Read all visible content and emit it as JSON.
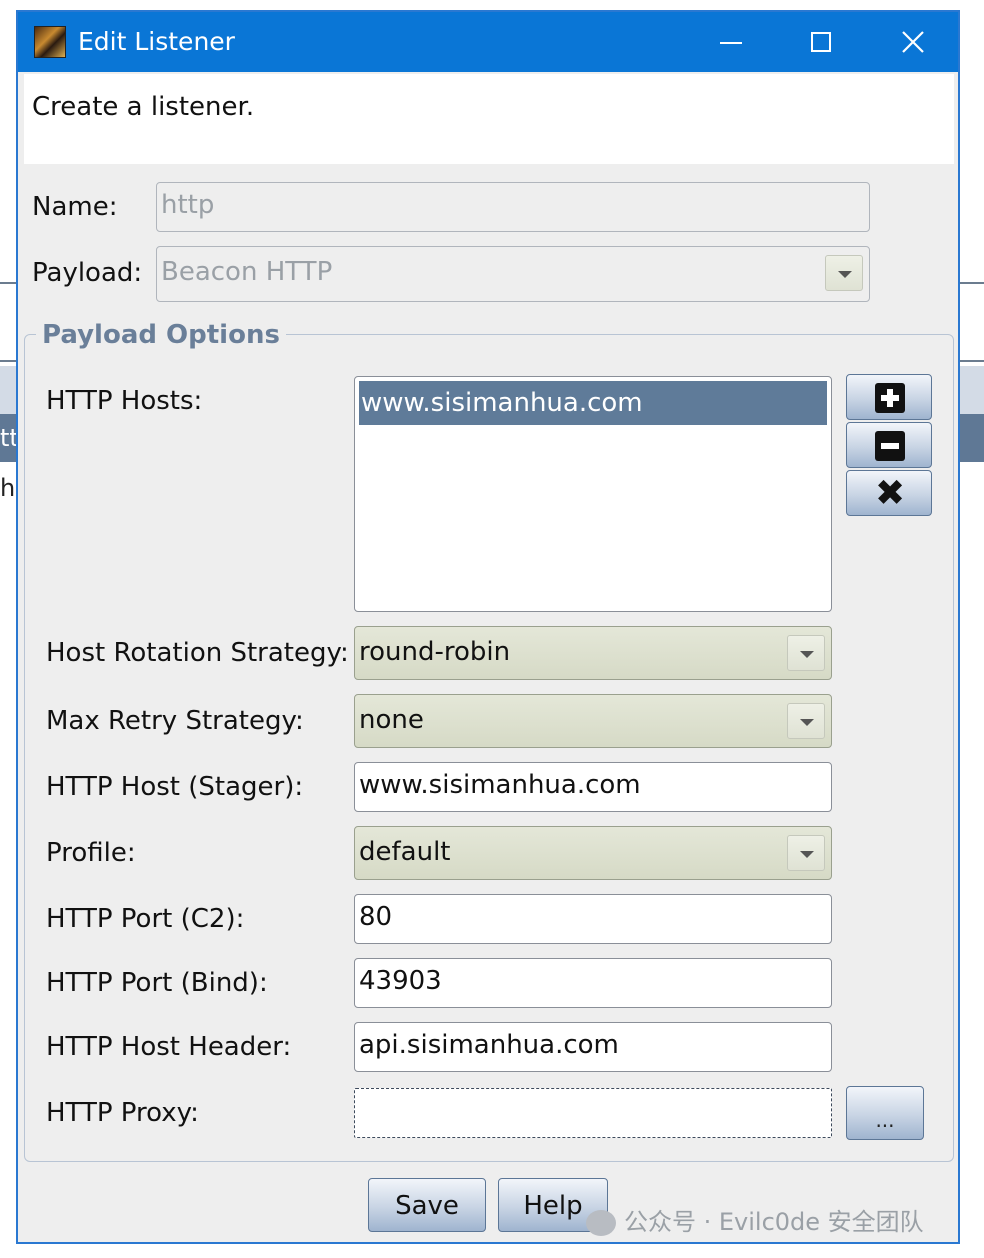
{
  "window": {
    "title": "Edit Listener"
  },
  "header": {
    "text": "Create a listener."
  },
  "form": {
    "name_label": "Name:",
    "name_value": "http",
    "payload_label": "Payload:",
    "payload_value": "Beacon HTTP"
  },
  "payload_options": {
    "title": "Payload Options",
    "http_hosts_label": "HTTP Hosts:",
    "http_hosts": [
      "www.sisimanhua.com"
    ],
    "rotation_label": "Host Rotation Strategy:",
    "rotation_value": "round-robin",
    "retry_label": "Max Retry Strategy:",
    "retry_value": "none",
    "stager_label": "HTTP Host (Stager):",
    "stager_value": "www.sisimanhua.com",
    "profile_label": "Profile:",
    "profile_value": "default",
    "port_c2_label": "HTTP Port (C2):",
    "port_c2_value": "80",
    "port_bind_label": "HTTP Port (Bind):",
    "port_bind_value": "43903",
    "host_header_label": "HTTP Host Header:",
    "host_header_value": "api.sisimanhua.com",
    "proxy_label": "HTTP Proxy:",
    "proxy_value": "",
    "proxy_button": "..."
  },
  "buttons": {
    "save": "Save",
    "help": "Help"
  },
  "background": {
    "fragment_1": "tt",
    "fragment_2": "h"
  },
  "watermark": {
    "text": "公众号 · Evilc0de 安全团队"
  },
  "icons": {
    "app": "app-icon",
    "add": "plus-icon",
    "remove": "minus-icon",
    "clear": "x-icon",
    "dropdown": "chevron-down-icon"
  },
  "colors": {
    "titlebar": "#0a76d6",
    "selection": "#5f7b99",
    "group_title": "#6a7f99"
  }
}
